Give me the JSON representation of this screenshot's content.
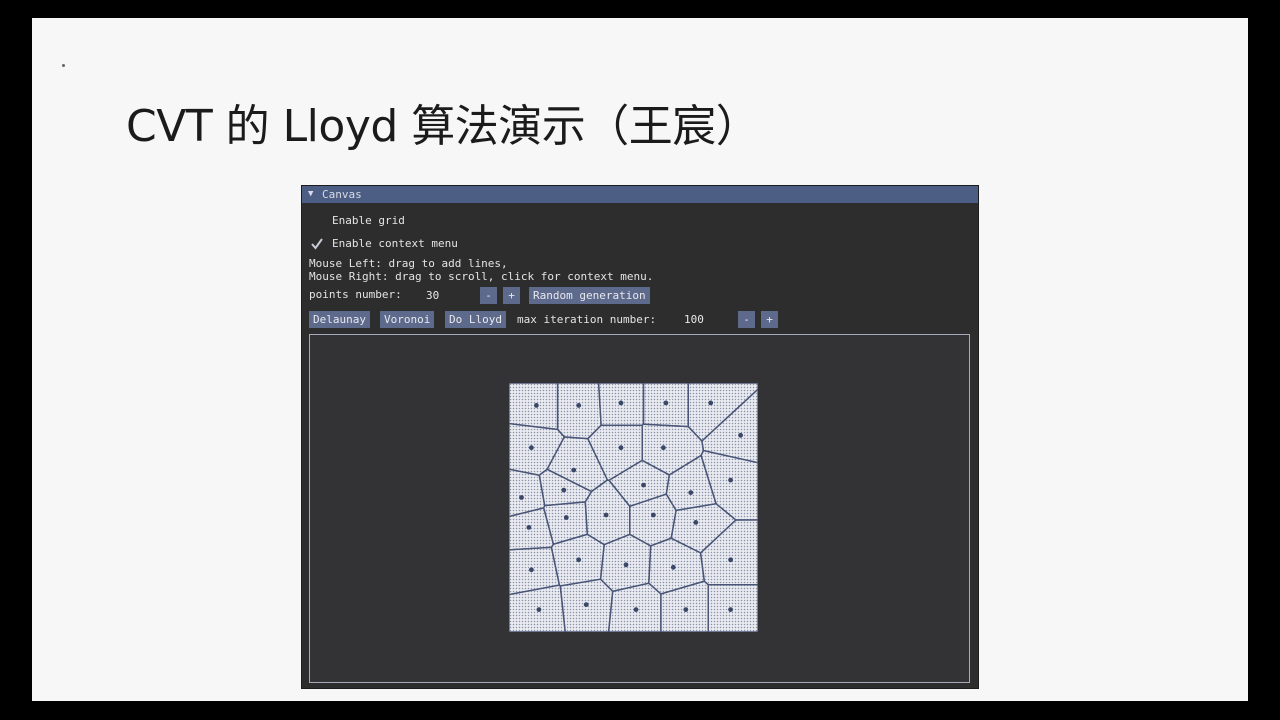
{
  "slide": {
    "title": "CVT 的 Lloyd 算法演示（王宸）"
  },
  "window": {
    "title": "Canvas",
    "collapse_icon": "triangle-down-icon"
  },
  "options": {
    "enable_grid": {
      "label": "Enable grid",
      "checked": false
    },
    "enable_context_menu": {
      "label": "Enable context menu",
      "checked": true
    }
  },
  "help": {
    "line1": "Mouse Left: drag to add lines,",
    "line2": "Mouse Right: drag to scroll, click for context menu."
  },
  "points": {
    "label": "points number:",
    "value": "30",
    "minus": "-",
    "plus": "+",
    "random_button": "Random generation"
  },
  "actions": {
    "delaunay": "Delaunay",
    "voronoi": "Voronoi",
    "do_lloyd": "Do Lloyd",
    "iter_label": "max iteration number:",
    "iter_value": "100",
    "minus": "-",
    "plus": "+"
  },
  "colors": {
    "titlebar": "#4d5e85",
    "button": "#5e6a8c",
    "window_bg": "#2d2d2e",
    "canvas_bg": "#333335",
    "cell_fill": "#e9ebf1",
    "cell_edge": "#4a5677",
    "site": "#3b4766"
  },
  "voronoi": {
    "sites": [
      [
        0.11,
        0.09
      ],
      [
        0.28,
        0.09
      ],
      [
        0.45,
        0.08
      ],
      [
        0.63,
        0.08
      ],
      [
        0.81,
        0.08
      ],
      [
        0.09,
        0.26
      ],
      [
        0.26,
        0.35
      ],
      [
        0.45,
        0.26
      ],
      [
        0.62,
        0.26
      ],
      [
        0.93,
        0.21
      ],
      [
        0.05,
        0.46
      ],
      [
        0.22,
        0.43
      ],
      [
        0.54,
        0.41
      ],
      [
        0.73,
        0.44
      ],
      [
        0.89,
        0.39
      ],
      [
        0.08,
        0.58
      ],
      [
        0.23,
        0.54
      ],
      [
        0.39,
        0.53
      ],
      [
        0.58,
        0.53
      ],
      [
        0.75,
        0.56
      ],
      [
        0.09,
        0.75
      ],
      [
        0.28,
        0.71
      ],
      [
        0.47,
        0.73
      ],
      [
        0.66,
        0.74
      ],
      [
        0.89,
        0.71
      ],
      [
        0.12,
        0.91
      ],
      [
        0.31,
        0.89
      ],
      [
        0.51,
        0.91
      ],
      [
        0.71,
        0.91
      ],
      [
        0.89,
        0.91
      ]
    ]
  }
}
